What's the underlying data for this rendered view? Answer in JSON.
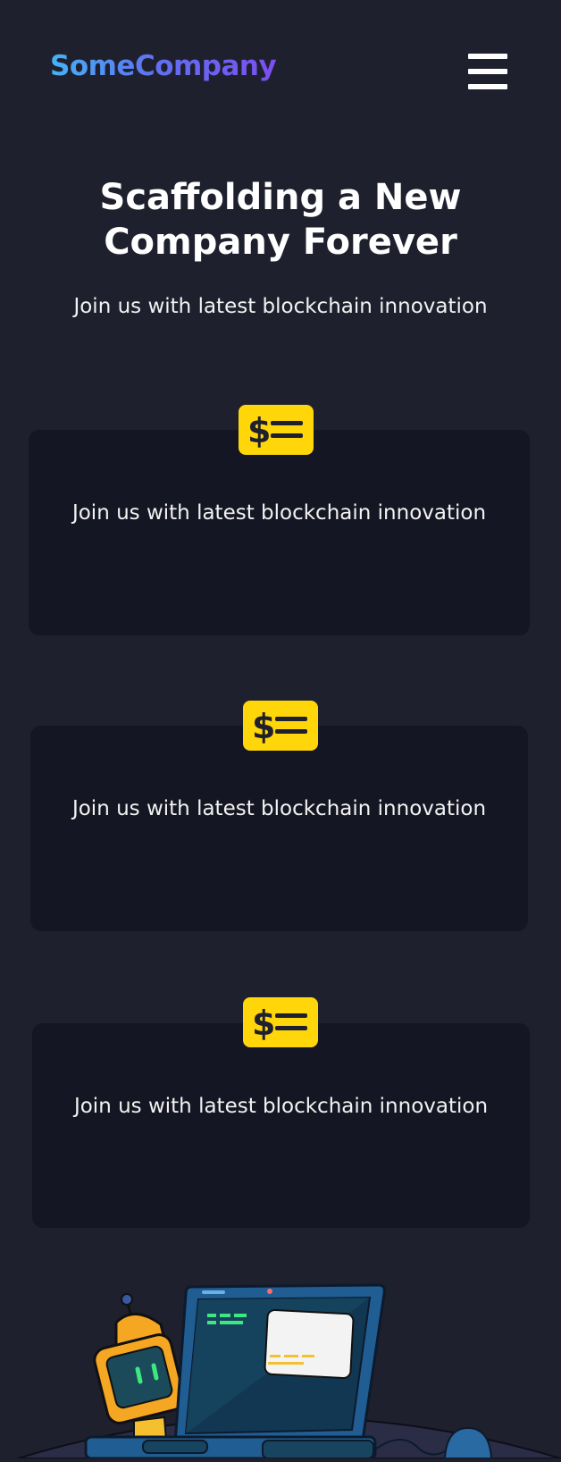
{
  "header": {
    "logo": "SomeCompany",
    "menu_icon": "hamburger-menu-icon"
  },
  "hero": {
    "title": "Scaffolding a New Company Forever",
    "subtitle": "Join us with latest blockchain innovation"
  },
  "features": [
    {
      "icon": "dollar-list-icon",
      "text": "Join us with latest blockchain innovation"
    },
    {
      "icon": "dollar-list-icon",
      "text": "Join us with latest blockchain innovation"
    },
    {
      "icon": "dollar-list-icon",
      "text": "Join us with latest blockchain innovation"
    }
  ],
  "colors": {
    "background": "#1f202e",
    "card": "#151623",
    "accent_yellow": "#ffd60a",
    "logo_gradient_start": "#44b3f5",
    "logo_gradient_end": "#7b4ff0"
  },
  "illustration": {
    "name": "robot-laptop-illustration"
  }
}
